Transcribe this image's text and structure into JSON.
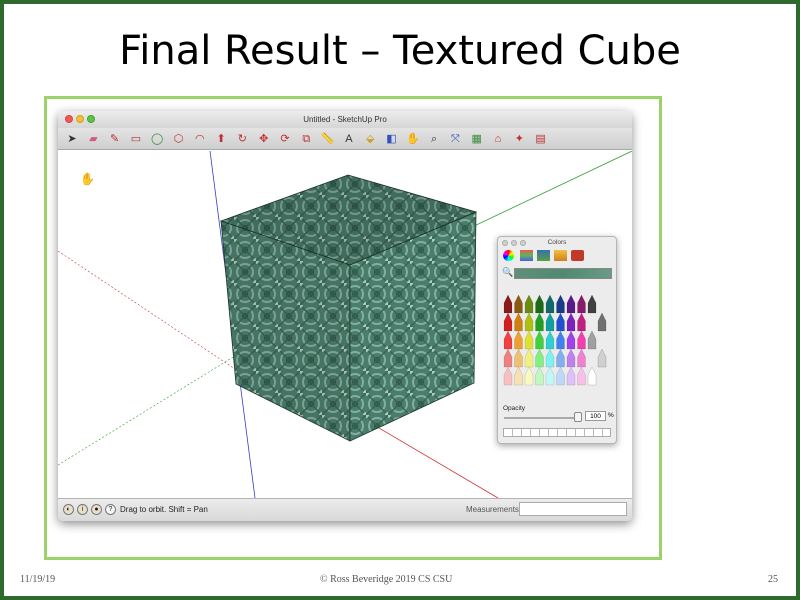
{
  "slide": {
    "title": "Final Result – Textured Cube",
    "footer_date": "11/19/19",
    "footer_center": "© Ross Beveridge  2019 CS CSU",
    "page_number": "25"
  },
  "window": {
    "title": "Untitled - SketchUp Pro",
    "toolbar_icons": [
      "select-icon",
      "eraser-icon",
      "pencil-icon",
      "rectangle-icon",
      "circle-icon",
      "polygon-icon",
      "arc-icon",
      "push-pull-icon",
      "follow-me-icon",
      "move-icon",
      "rotate-icon",
      "offset-icon",
      "tape-measure-icon",
      "text-icon",
      "paint-bucket-icon",
      "section-plane-icon",
      "orbit-icon",
      "zoom-icon",
      "zoom-extents-icon",
      "components-icon",
      "warehouse-icon",
      "extension-icon",
      "layout-icon"
    ]
  },
  "status": {
    "text": "Drag to orbit.  Shift = Pan",
    "measurements_label": "Measurements"
  },
  "colors_panel": {
    "title": "Colors",
    "opacity_label": "Opacity",
    "opacity_value": "100",
    "opacity_unit": "%",
    "crayon_colors": [
      [
        "#8a1a1a",
        "#8a5a10",
        "#6a8a10",
        "#1a6a1a",
        "#106a6a",
        "#1a3a8a",
        "#5a1a8a",
        "#8a1a6a"
      ],
      [
        "#d02020",
        "#d08010",
        "#b0c010",
        "#20a020",
        "#10a0a0",
        "#2050d0",
        "#8020c0",
        "#c02080"
      ],
      [
        "#f04040",
        "#f0a030",
        "#e0e030",
        "#40d040",
        "#30d0d0",
        "#4080f0",
        "#a040f0",
        "#f040b0"
      ],
      [
        "#f08080",
        "#f0c070",
        "#f0f080",
        "#80f080",
        "#80f0f0",
        "#80b0f0",
        "#c080f0",
        "#f080d0"
      ],
      [
        "#f8c0c0",
        "#f8e0b0",
        "#f8f8c0",
        "#c0f8c0",
        "#c0f8f8",
        "#c0d8f8",
        "#e0c0f8",
        "#f8c0e8"
      ]
    ],
    "gray_crayons": [
      "#404040",
      "#707070",
      "#a0a0a0",
      "#d0d0d0",
      "#ffffff"
    ]
  },
  "scene": {
    "cube_texture": "teal-green patterned texture",
    "axis_colors": {
      "red": "#d03030",
      "green": "#30a030",
      "blue": "#3040c0"
    }
  }
}
